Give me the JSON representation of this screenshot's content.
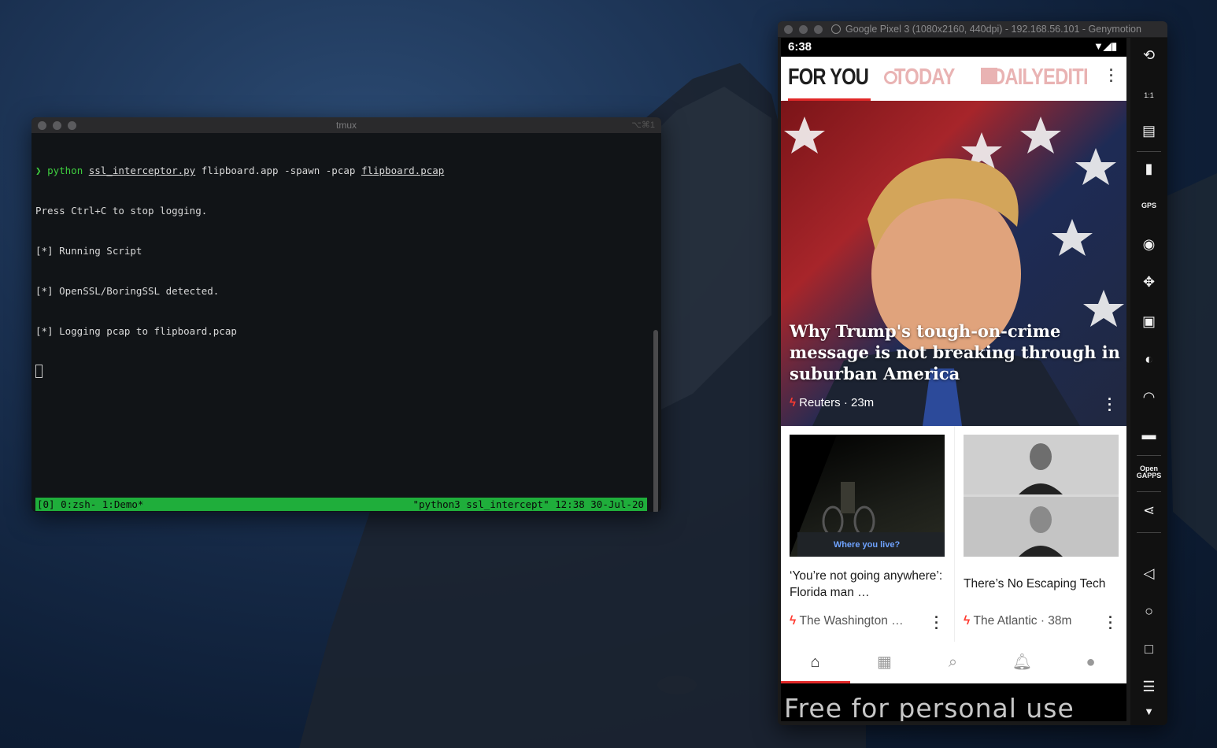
{
  "terminal": {
    "title": "tmux",
    "shortcut": "⌥⌘1",
    "lines": [
      {
        "prompt": "❯",
        "cmd": "python",
        "args1": "ssl_interceptor.py",
        "args2": " flipboard.app -spawn -pcap ",
        "args3": "flipboard.pcap"
      },
      "Press Ctrl+C to stop logging.",
      "[*] Running Script",
      "[*] OpenSSL/BoringSSL detected.",
      "[*] Logging pcap to flipboard.pcap"
    ],
    "status_left": "[0] 0:zsh- 1:Demo*",
    "status_right": "\"python3 ssl_intercept\" 12:38 30-Jul-20"
  },
  "emulator": {
    "title": "Google Pixel 3 (1080x2160, 440dpi) - 192.168.56.101 - Genymotion",
    "status_time": "6:38",
    "tabs": {
      "for_you": "FOR YOU",
      "today": "TODAY",
      "daily": "DAILYEDITI"
    },
    "hero": {
      "headline": "Why Trump's tough-on-crime message is not breaking through in suburban America",
      "source": "Reuters · 23m"
    },
    "cards": [
      {
        "thumb_caption": "Where you live?",
        "title": "‘You’re not going anywhere’: Florida man …",
        "source": "The Washington …"
      },
      {
        "title": "There’s No Escaping Tech",
        "source": "The Atlantic · 38m"
      }
    ],
    "nav": [
      "home-icon",
      "grid-icon",
      "search-icon",
      "bell-icon",
      "profile-icon"
    ],
    "watermark": "Free for personal use",
    "side_toolbar": [
      "rotate-icon",
      "pixel-perfect-icon",
      "capture-icon",
      "battery-icon",
      "gps-icon",
      "camera-icon",
      "dpad-icon",
      "device-id-icon",
      "media-icon",
      "cast-icon",
      "sms-icon",
      "opengapps-icon",
      "share-icon",
      "back-icon",
      "home-circle-icon",
      "recents-icon",
      "menu-icon",
      "scroll-down-icon"
    ],
    "side_labels": {
      "gps": "GPS",
      "opengapps_1": "Open",
      "opengapps_2": "GAPPS",
      "pixel": "1:1"
    }
  }
}
